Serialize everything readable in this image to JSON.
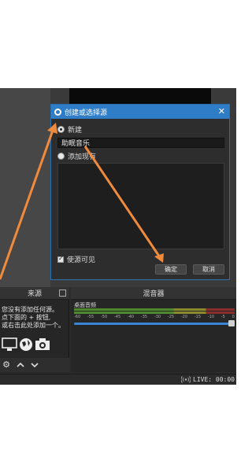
{
  "dialog": {
    "title": "创建或选择源",
    "close_glyph": "✕",
    "option_new": "新建",
    "name_value": "助眠音乐",
    "option_existing": "添加现有",
    "visible_label": "使源可见",
    "ok_label": "确定",
    "cancel_label": "取消"
  },
  "sources": {
    "header": "来源",
    "empty_text": "您没有添加任何源。\n点下面的 + 按钮,\n或右击此处添加一个。",
    "toolbar": [
      "gear-icon",
      "chevron-up-icon",
      "chevron-down-icon"
    ]
  },
  "mixer": {
    "header": "混音器",
    "track_name": "桌面音频",
    "scale": [
      "-60",
      "-55",
      "-50",
      "-45",
      "-40",
      "-35",
      "-30",
      "-25",
      "-20",
      "-15",
      "-10",
      "-5",
      "0"
    ]
  },
  "status": {
    "live_label": "LIVE: 00:00"
  },
  "colors": {
    "accent": "#2f7cc7",
    "arrow": "#f08a3c"
  }
}
